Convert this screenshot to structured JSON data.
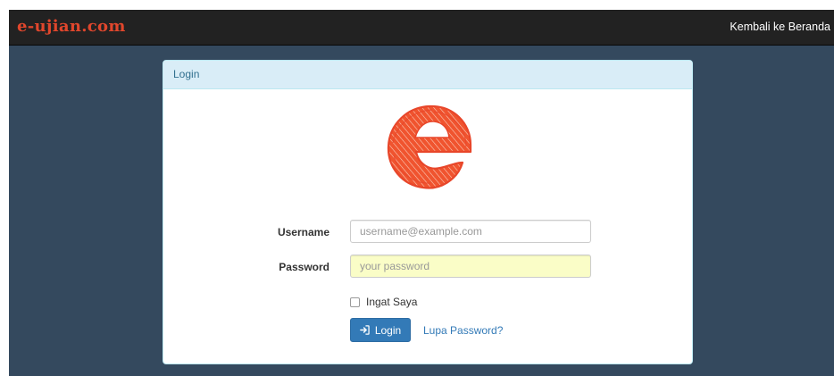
{
  "navbar": {
    "brand": "e-ujian.com",
    "back_link": "Kembali ke Beranda"
  },
  "panel": {
    "title": "Login"
  },
  "logo": {
    "icon": "letter-e-logo",
    "letter": "e",
    "color": "#f0542f"
  },
  "form": {
    "username_label": "Username",
    "username_placeholder": "username@example.com",
    "username_value": "",
    "password_label": "Password",
    "password_placeholder": "your password",
    "password_value": "",
    "remember_label": "Ingat Saya",
    "remember_checked": false,
    "login_button": "Login",
    "login_icon": "sign-in-icon",
    "forgot_link": "Lupa Password?"
  },
  "colors": {
    "background": "#34495e",
    "navbar": "#222222",
    "brand": "#e0462c",
    "panel_heading": "#d9edf7",
    "primary": "#337ab7",
    "autofill": "#fafdc7"
  }
}
